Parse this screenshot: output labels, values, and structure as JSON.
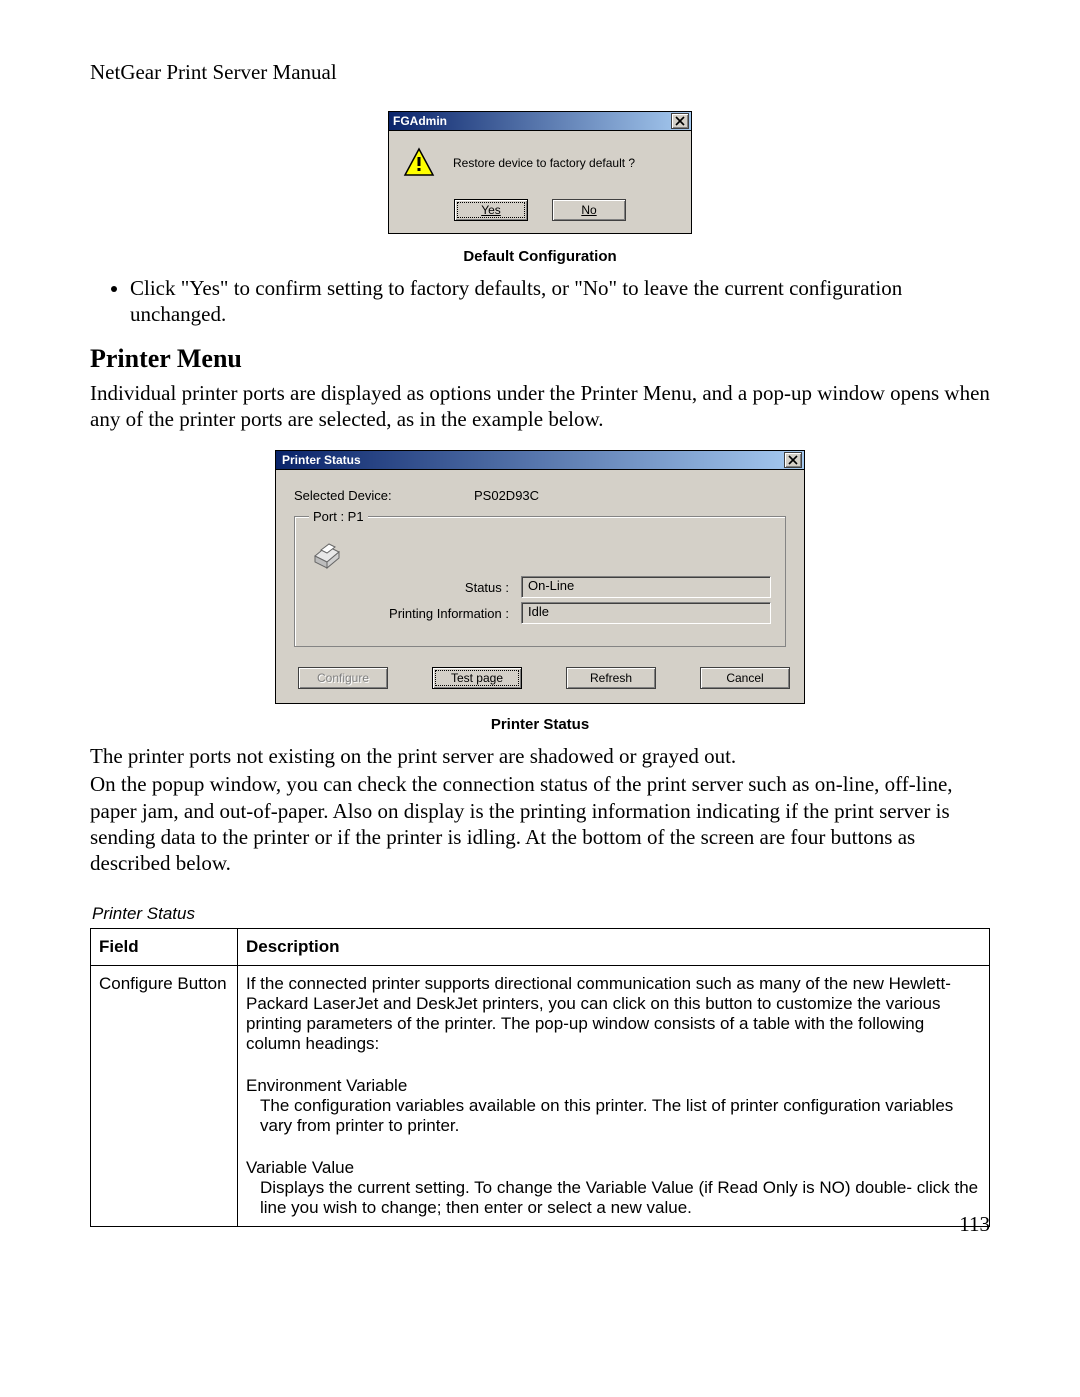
{
  "doc_title": "NetGear Print Server Manual",
  "dialog1": {
    "title": "FGAdmin",
    "message": "Restore device to factory default ?",
    "yes": "Yes",
    "no": "No"
  },
  "fig1_caption": "Default Configuration",
  "bullet1": "Click \"Yes\" to confirm setting to factory defaults, or \"No\" to leave the current configuration unchanged.",
  "section_heading": "Printer Menu",
  "para1": "Individual printer ports are displayed as options under the Printer Menu, and a pop-up window opens when any of the printer ports are selected, as in the example below.",
  "dialog2": {
    "title": "Printer Status",
    "selected_device_label": "Selected Device:",
    "selected_device_value": "PS02D93C",
    "port_label": "Port : P1",
    "status_label": "Status :",
    "status_value": "On-Line",
    "printinfo_label": "Printing Information :",
    "printinfo_value": "Idle",
    "btn_configure": "Configure",
    "btn_testpage": "Test page",
    "btn_refresh": "Refresh",
    "btn_cancel": "Cancel"
  },
  "fig2_caption": "Printer Status",
  "para2": "The printer ports not existing on the print server are shadowed or grayed out.",
  "para3": "On the popup window, you can check the connection status of the print server such as on-line, off-line, paper jam, and out-of-paper. Also on display is the printing information indicating if the print server is sending data to the printer or if the printer is idling. At the bottom of the screen are four buttons as described below.",
  "table_title": "Printer Status",
  "table": {
    "head_field": "Field",
    "head_desc": "Description",
    "row1": {
      "field": "Configure Button",
      "desc_main": "If the connected printer supports directional communication such as many of the new Hewlett-Packard LaserJet and DeskJet printers, you can click on this button to customize the various printing parameters of the printer. The pop-up window consists of a table with the following column headings:",
      "env_head": "Environment Variable",
      "env_body": "The configuration variables available on this printer. The list of printer configuration variables vary from printer to printer.",
      "val_head": "Variable Value",
      "val_body": "Displays the current setting. To change the Variable Value (if Read Only is NO) double- click the line you wish to change; then enter or select a new value."
    }
  },
  "page_number": "113"
}
